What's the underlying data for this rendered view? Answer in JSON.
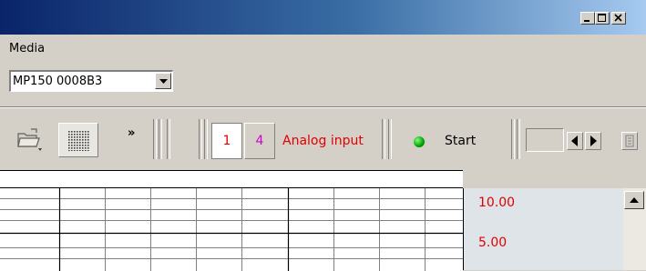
{
  "menubar": {
    "items": [
      {
        "label": "Media"
      }
    ]
  },
  "device": {
    "selected": "MP150 0008B3"
  },
  "toolbar": {
    "more_glyph": "»",
    "channels": [
      {
        "label": "1",
        "color": "#e00000"
      },
      {
        "label": "4",
        "color": "#d000d0"
      }
    ],
    "channel_label": "Analog input",
    "start_label": "Start",
    "status_color": "#00a000"
  },
  "scale": {
    "upper": "10.00",
    "lower": "5.00"
  },
  "colors": {
    "title_gradient_start": "#0a246a",
    "title_gradient_end": "#a6caf0",
    "label_red": "#e00000"
  }
}
